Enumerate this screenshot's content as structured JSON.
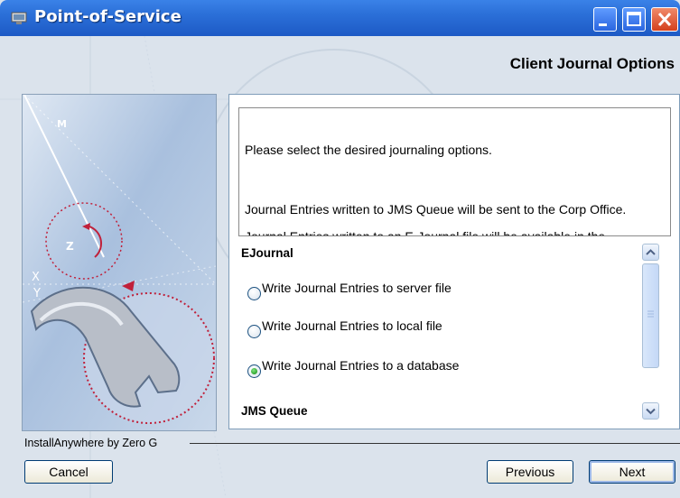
{
  "window": {
    "title": "Point-of-Service"
  },
  "header": {
    "title": "Client Journal Options"
  },
  "description": {
    "lines": [
      "Please select the desired journaling options.",
      "Journal Entries written to JMS Queue will be sent to the Corp Office.",
      "Journal Entries written to an E-Journal file will be available in the"
    ]
  },
  "ejournal": {
    "title": "EJournal",
    "options": [
      {
        "label": "Write Journal Entries to server file",
        "selected": false
      },
      {
        "label": "Write Journal Entries to local file",
        "selected": false
      },
      {
        "label": "Write Journal Entries to a database",
        "selected": true
      }
    ]
  },
  "jms": {
    "title": "JMS Queue"
  },
  "footer": {
    "label": "InstallAnywhere by Zero G"
  },
  "buttons": {
    "cancel": "Cancel",
    "previous": "Previous",
    "next": "Next"
  },
  "decoration": {
    "letters": [
      "M",
      "Z",
      "X",
      "Y"
    ]
  },
  "colors": {
    "titlebar": "#2b6fd8",
    "close": "#d4401c",
    "radio_selected": "#2ea42e"
  }
}
